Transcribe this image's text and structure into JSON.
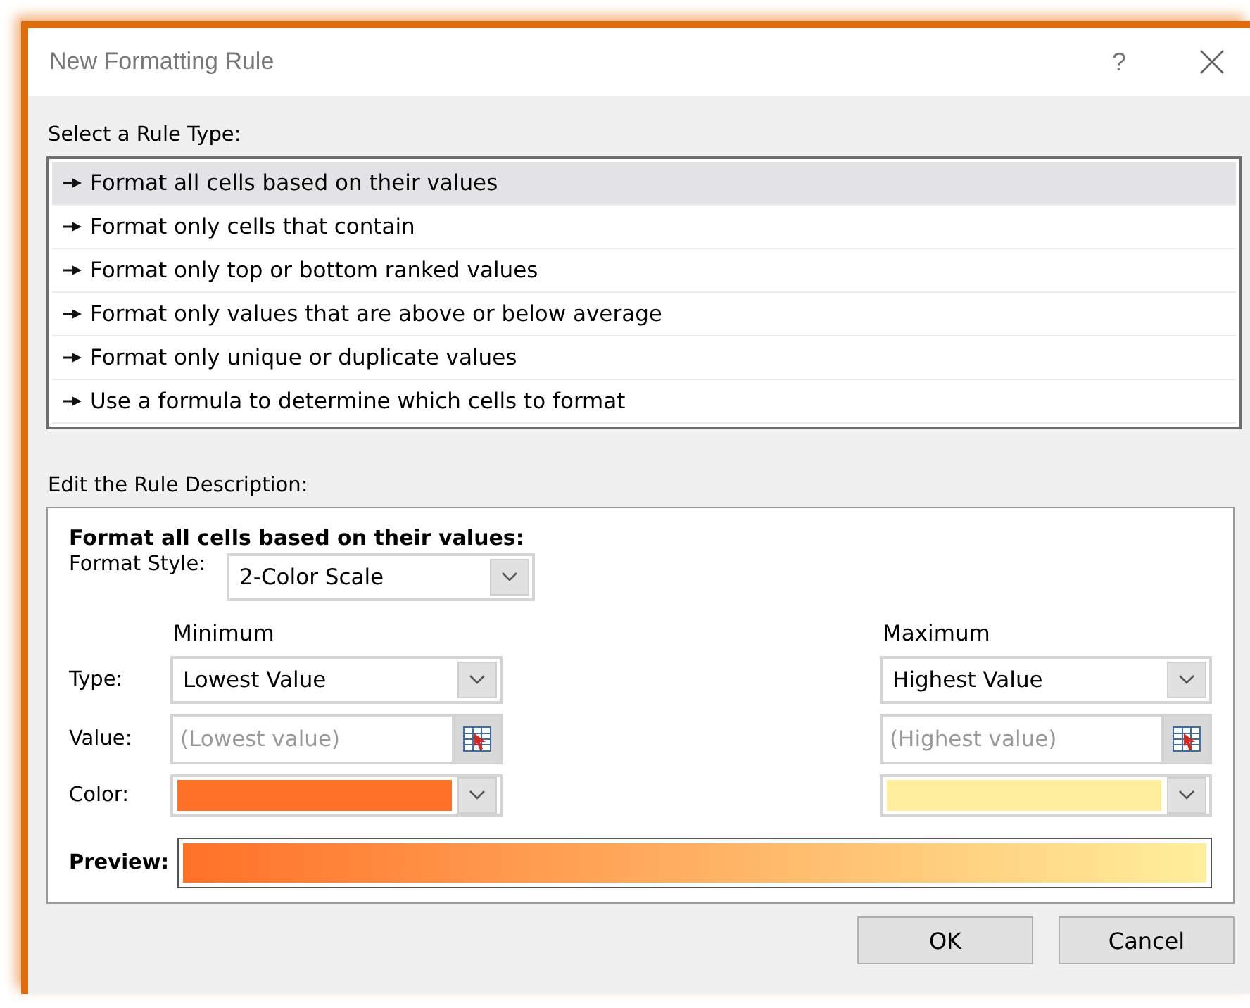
{
  "window": {
    "title": "New Formatting Rule",
    "help": "?"
  },
  "rule_type": {
    "label": "Select a Rule Type:",
    "items": [
      {
        "label": "Format all cells based on their values",
        "selected": true
      },
      {
        "label": "Format only cells that contain",
        "selected": false
      },
      {
        "label": "Format only top or bottom ranked values",
        "selected": false
      },
      {
        "label": "Format only values that are above or below average",
        "selected": false
      },
      {
        "label": "Format only unique or duplicate values",
        "selected": false
      },
      {
        "label": "Use a formula to determine which cells to format",
        "selected": false
      }
    ]
  },
  "description": {
    "label": "Edit the Rule Description:",
    "heading": "Format all cells based on their values:",
    "format_style": {
      "label": "Format Style:",
      "value": "2-Color Scale"
    },
    "row_labels": [
      "Type:",
      "Value:",
      "Color:"
    ],
    "minimum": {
      "heading": "Minimum",
      "type": "Lowest Value",
      "placeholder": "(Lowest value)",
      "color": "#ff7128"
    },
    "maximum": {
      "heading": "Maximum",
      "type": "Highest Value",
      "placeholder": "(Highest value)",
      "color": "#ffef9c"
    },
    "preview": {
      "label": "Preview:"
    }
  },
  "buttons": [
    "OK",
    "Cancel"
  ]
}
